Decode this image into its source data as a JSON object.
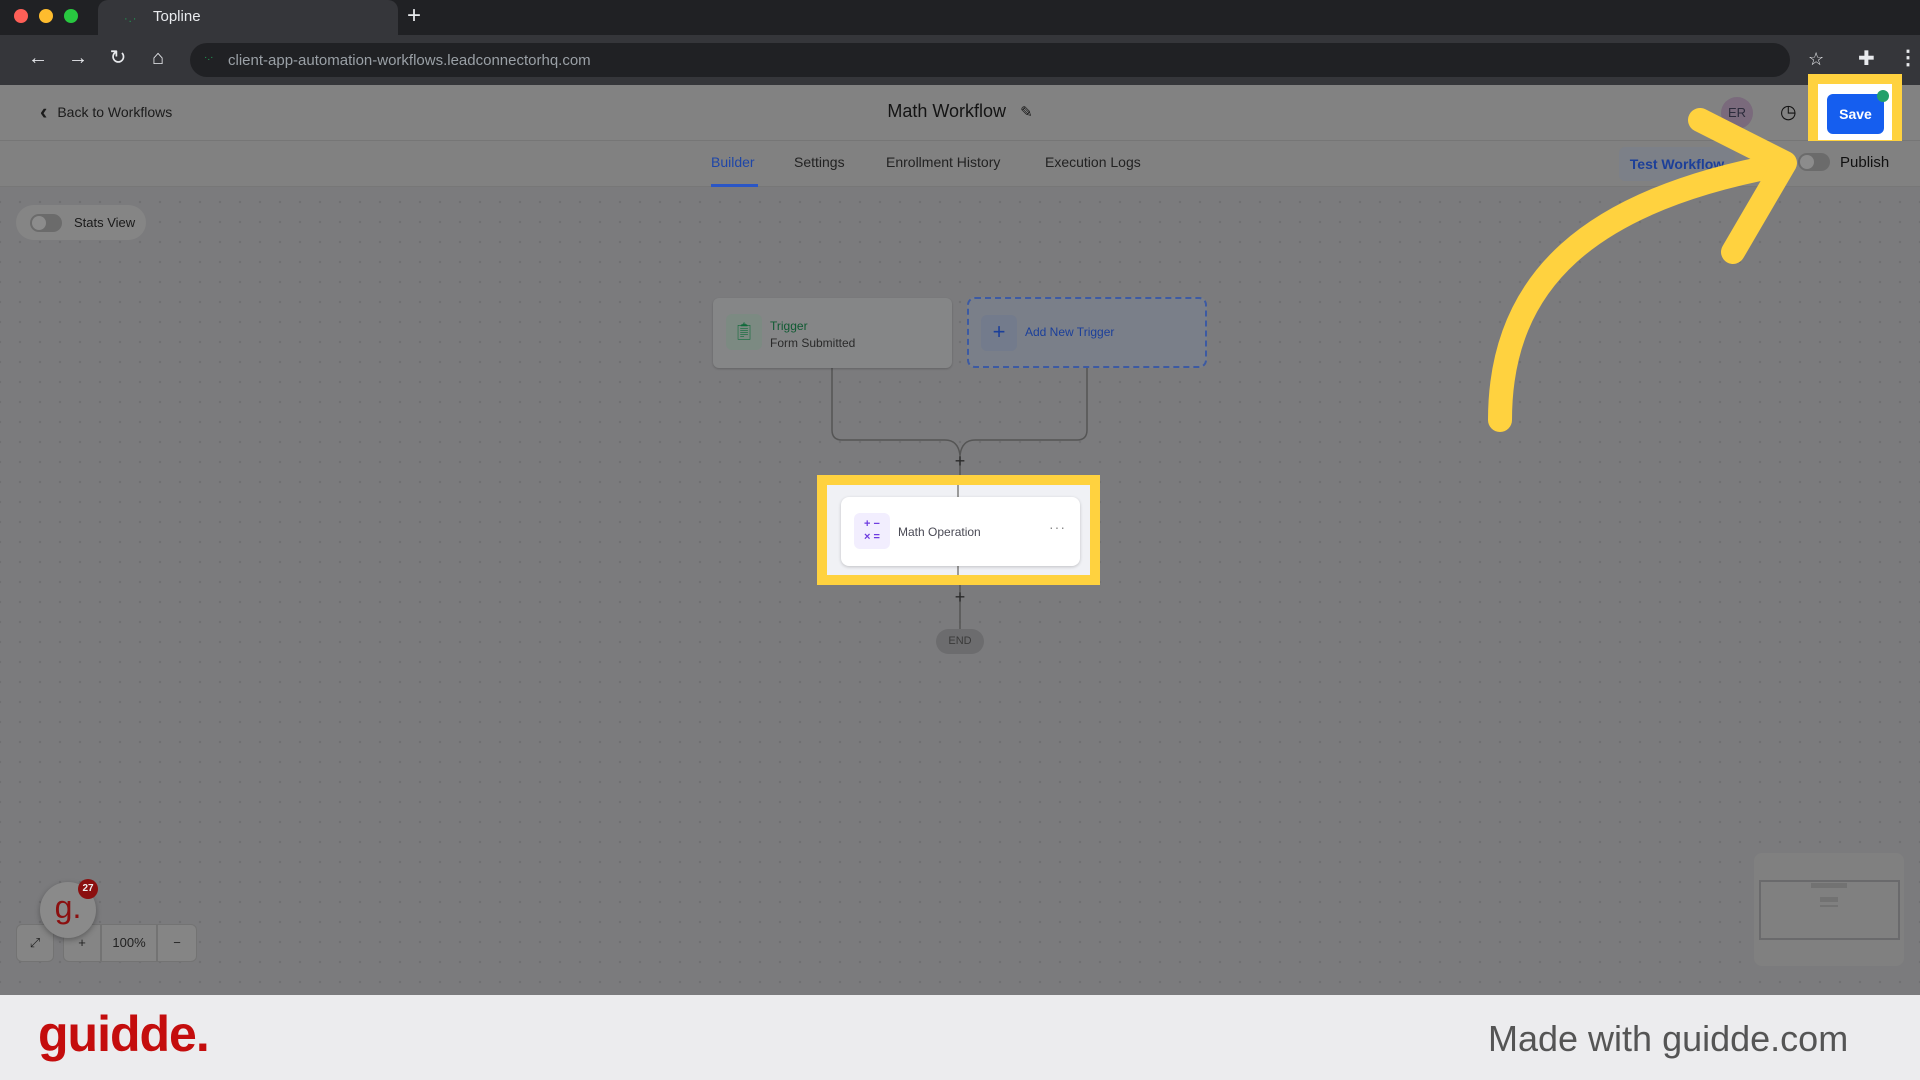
{
  "browser": {
    "tab_title": "Topline",
    "new_tab_label": "+",
    "url": "client-app-automation-workflows.leadconnectorhq.com",
    "icons": {
      "back": "arrow-left-icon",
      "forward": "arrow-right-icon",
      "reload": "reload-icon",
      "home": "home-icon",
      "bookmark": "star-icon",
      "extensions": "puzzle-icon",
      "menu": "more-vertical-icon"
    }
  },
  "header": {
    "back_label": "Back to Workflows",
    "workflow_title": "Math Workflow",
    "avatar_initials": "ER",
    "save_label": "Save"
  },
  "tabs": [
    {
      "label": "Builder",
      "active": true
    },
    {
      "label": "Settings",
      "active": false
    },
    {
      "label": "Enrollment History",
      "active": false
    },
    {
      "label": "Execution Logs",
      "active": false
    }
  ],
  "actions": {
    "test_workflow_label": "Test Workflow",
    "publish_label": "Publish",
    "publish_on": false
  },
  "canvas": {
    "stats_view_label": "Stats View",
    "stats_view_on": false,
    "trigger": {
      "title": "Trigger",
      "subtitle": "Form Submitted"
    },
    "add_trigger_label": "Add New Trigger",
    "action_node": {
      "label": "Math Operation",
      "icon_glyph": "+ −\n× ="
    },
    "end_label": "END",
    "zoom_level": "100%"
  },
  "guidde": {
    "bubble_glyph": "g.",
    "badge_count": "27",
    "logo": "guidde.",
    "made_with": "Made with guidde.com"
  },
  "colors": {
    "highlight": "#ffd23f",
    "save_blue": "#155eef",
    "guidde_red": "#c40d0d"
  }
}
